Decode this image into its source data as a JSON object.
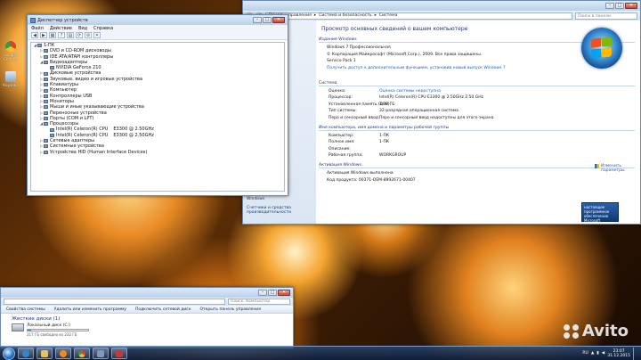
{
  "desktop": {
    "icons": [
      {
        "label": "Google Chrome",
        "color": "#d8432f"
      },
      {
        "label": "Корзина",
        "color": "#8aa6c8"
      }
    ]
  },
  "device_manager": {
    "title": "Диспетчер устройств",
    "menu": [
      "Файл",
      "Действие",
      "Вид",
      "Справка"
    ],
    "toolbar_icons": [
      "back-icon",
      "forward-icon",
      "properties-icon",
      "help-icon",
      "scan-icon",
      "update-icon",
      "disable-icon",
      "uninstall-icon"
    ],
    "tree": [
      {
        "label": "1-ПК",
        "level": 0,
        "expanded": true
      },
      {
        "label": "DVD и CD-ROM дисководы",
        "level": 1,
        "expanded": false
      },
      {
        "label": "IDE ATA/ATAPI контроллеры",
        "level": 1,
        "expanded": false
      },
      {
        "label": "Видеоадаптеры",
        "level": 1,
        "expanded": true
      },
      {
        "label": "NVIDIA GeForce 210",
        "level": 2
      },
      {
        "label": "Дисковые устройства",
        "level": 1,
        "expanded": false
      },
      {
        "label": "Звуковые, видео и игровые устройства",
        "level": 1,
        "expanded": false
      },
      {
        "label": "Клавиатуры",
        "level": 1,
        "expanded": false
      },
      {
        "label": "Компьютер",
        "level": 1,
        "expanded": false
      },
      {
        "label": "Контроллеры USB",
        "level": 1,
        "expanded": false
      },
      {
        "label": "Мониторы",
        "level": 1,
        "expanded": false
      },
      {
        "label": "Мыши и иные указывающие устройства",
        "level": 1,
        "expanded": false
      },
      {
        "label": "Переносные устройства",
        "level": 1,
        "expanded": false
      },
      {
        "label": "Порты (COM и LPT)",
        "level": 1,
        "expanded": false
      },
      {
        "label": "Процессоры",
        "level": 1,
        "expanded": true
      },
      {
        "label": "Intel(R) Celeron(R) CPU",
        "value": "E3300  @ 2.50GHz",
        "level": 2
      },
      {
        "label": "Intel(R) Celeron(R) CPU",
        "value": "E3300  @ 2.50GHz",
        "level": 2
      },
      {
        "label": "Сетевые адаптеры",
        "level": 1,
        "expanded": false
      },
      {
        "label": "Системные устройства",
        "level": 1,
        "expanded": false
      },
      {
        "label": "Устройства HID (Human Interface Devices)",
        "level": 1,
        "expanded": false
      }
    ]
  },
  "system_window": {
    "breadcrumbs": [
      "Панель управления",
      "Система и безопасность",
      "Система"
    ],
    "search_placeholder": "Поиск в панели управления",
    "heading": "Просмотр основных сведений о вашем компьютере",
    "edition_title": "Издание Windows",
    "edition": "Windows 7 Профессиональная",
    "copyright": "© Корпорация Майкрософт (Microsoft Corp.), 2009. Все права защищены.",
    "service_pack": "Service Pack 1",
    "more_features_link": "Получить доступ к дополнительным функциям, установив новый выпуск Windows 7",
    "system_title": "Система",
    "system_rows": [
      {
        "k": "Оценка:",
        "v": "Оценка системы недоступна",
        "link": true
      },
      {
        "k": "Процессор:",
        "v": "Intel(R) Celeron(R) CPU        E3300  @ 2.50GHz  2.50 GHz"
      },
      {
        "k": "Установленная память (ОЗУ):",
        "v": "3,00 ГБ"
      },
      {
        "k": "Тип системы:",
        "v": "32-разрядная операционная система"
      },
      {
        "k": "Перо и сенсорный ввод:",
        "v": "Перо и сенсорный ввод недоступны для этого экрана"
      }
    ],
    "name_title": "Имя компьютера, имя домена и параметры рабочей группы",
    "name_rows": [
      {
        "k": "Компьютер:",
        "v": "1-ПК"
      },
      {
        "k": "Полное имя:",
        "v": "1-ПК"
      },
      {
        "k": "Описание:",
        "v": ""
      },
      {
        "k": "Рабочая группа:",
        "v": "WORKGROUP"
      }
    ],
    "change_params": "Изменить параметры",
    "activation_title": "Активация Windows",
    "activation_status": "Активация Windows выполнена",
    "product_code": "Код продукта: 00371-OEM-8992671-00407",
    "left_tasks": [
      "Windows",
      "Счетчики и средства производительности"
    ],
    "genuine_text": "настоящее программное обеспечение Microsoft"
  },
  "explorer": {
    "search_placeholder": "Поиск: Компьютер",
    "toolbar": [
      "Свойства системы",
      "Удалить или изменить программу",
      "Подключить сетевой диск",
      "Открыть панель управления"
    ],
    "group": "Жесткие диски (1)",
    "drive_label": "Локальный диск (C:)",
    "drive_free": "217 ГБ свободно из 232 ГБ",
    "drive_used_fraction": 0.065
  },
  "taskbar": {
    "language": "RU",
    "time": "23:07",
    "date": "31.12.2015"
  },
  "watermark": "Avito"
}
